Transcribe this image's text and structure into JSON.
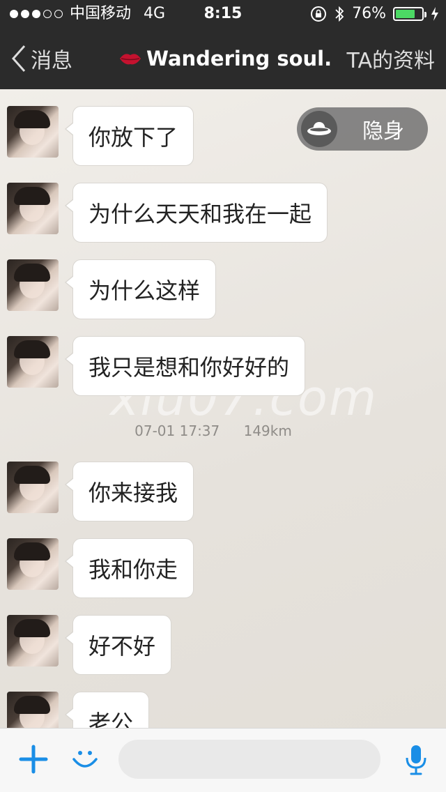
{
  "status_bar": {
    "carrier": "中国移动",
    "network": "4G",
    "time": "8:15",
    "battery_percent": "76%",
    "battery_level": 0.76,
    "signal_bars_filled": 3,
    "signal_bars_total": 5
  },
  "nav": {
    "back_label": "消息",
    "title": "Wandering soul.",
    "right_label": "TA的资料"
  },
  "stealth_toggle": {
    "label": "隐身"
  },
  "messages": [
    {
      "text": "你放下了"
    },
    {
      "text": "为什么天天和我在一起"
    },
    {
      "text": "为什么这样"
    },
    {
      "text": "我只是想和你好好的"
    },
    {
      "text": "你来接我"
    },
    {
      "text": "我和你走"
    },
    {
      "text": "好不好"
    },
    {
      "text": "老公"
    }
  ],
  "timestamp": {
    "datetime": "07-01 17:37",
    "distance": "149km"
  },
  "watermark": "xiu07.com",
  "colors": {
    "header_bg": "#2b2b2b",
    "accent_blue": "#1a8ee6",
    "battery_green": "#4cd964"
  }
}
